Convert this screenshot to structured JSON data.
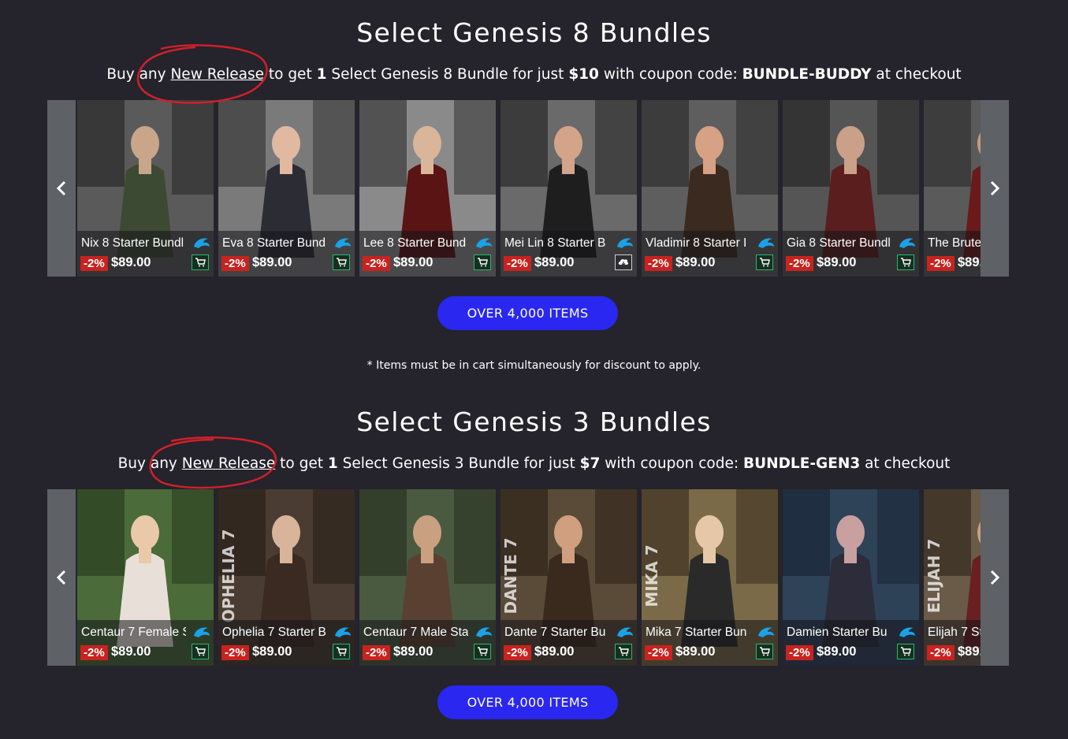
{
  "genesis8": {
    "title": "Select Genesis 8 Bundles",
    "promo": {
      "p1": "Buy any ",
      "link": "New Release",
      "p2": " to get ",
      "qty": "1",
      "p3": " Select Genesis 8 Bundle for just ",
      "price": "$10",
      "p4": " with coupon code: ",
      "code": "BUNDLE-BUDDY",
      "p5": " at checkout"
    },
    "products": [
      {
        "name": "Nix 8 Starter Bundl",
        "discount": "-2%",
        "price": "$89.00",
        "action": "cart"
      },
      {
        "name": "Eva 8 Starter Bund",
        "discount": "-2%",
        "price": "$89.00",
        "action": "cart"
      },
      {
        "name": "Lee 8 Starter Bund",
        "discount": "-2%",
        "price": "$89.00",
        "action": "cart"
      },
      {
        "name": "Mei Lin 8 Starter B",
        "discount": "-2%",
        "price": "$89.00",
        "action": "download"
      },
      {
        "name": "Vladimir 8 Starter I",
        "discount": "-2%",
        "price": "$89.00",
        "action": "cart"
      },
      {
        "name": "Gia 8 Starter Bundl",
        "discount": "-2%",
        "price": "$89.00",
        "action": "cart"
      },
      {
        "name": "The Brute",
        "discount": "-2%",
        "price": "$89.",
        "action": "cart"
      }
    ],
    "cta": "OVER 4,000 ITEMS",
    "note": "* Items must be in cart simultaneously for discount to apply."
  },
  "genesis3": {
    "title": "Select Genesis 3 Bundles",
    "promo": {
      "p1": "Buy any ",
      "link": "New Release",
      "p2": " to get ",
      "qty": "1",
      "p3": " Select Genesis 3 Bundle for just ",
      "price": "$7",
      "p4": " with coupon code: ",
      "code": "BUNDLE-GEN3",
      "p5": " at checkout"
    },
    "products": [
      {
        "name": "Centaur 7 Female S",
        "discount": "-2%",
        "price": "$89.00",
        "action": "cart"
      },
      {
        "name": "Ophelia 7 Starter B",
        "discount": "-2%",
        "price": "$89.00",
        "action": "cart"
      },
      {
        "name": "Centaur 7 Male Sta",
        "discount": "-2%",
        "price": "$89.00",
        "action": "cart"
      },
      {
        "name": "Dante 7 Starter Bu",
        "discount": "-2%",
        "price": "$89.00",
        "action": "cart"
      },
      {
        "name": "Mika 7 Starter Bun",
        "discount": "-2%",
        "price": "$89.00",
        "action": "cart"
      },
      {
        "name": "Damien Starter Bu",
        "discount": "-2%",
        "price": "$89.00",
        "action": "cart"
      },
      {
        "name": "Elijah 7 St",
        "discount": "-2%",
        "price": "$89.",
        "action": "cart"
      }
    ],
    "cover_text": [
      "",
      "OPHELIA 7",
      "",
      "DANTE 7",
      "MIKA 7",
      "",
      "ELIJAH 7"
    ],
    "cta": "OVER 4,000 ITEMS"
  },
  "colors": {
    "background": "#25232b",
    "cta": "#2a27f0",
    "discount": "#c8231f",
    "cart_border": "#2bb673",
    "arrow_bg": "#5e6166",
    "annotation": "#d0202a"
  },
  "icons": [
    "chevron-left-icon",
    "chevron-right-icon",
    "brand-logo-icon",
    "cart-icon",
    "download-icon"
  ]
}
